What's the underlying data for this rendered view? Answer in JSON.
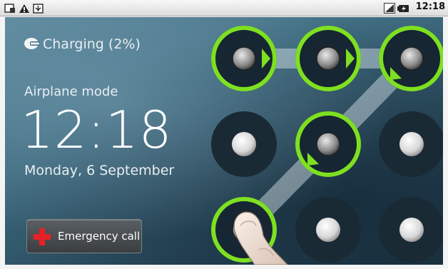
{
  "status_bar": {
    "left_icons": [
      "usb-debug-icon",
      "warning-icon",
      "usb-icon"
    ],
    "right_icons": [
      "signal-icon",
      "battery-charging-icon"
    ],
    "time": "12:18"
  },
  "lock_screen": {
    "charging_text": "Charging (2%)",
    "airplane_mode": "Airplane mode",
    "clock": "12:18",
    "date": "Monday, 6 September",
    "emergency_button": "Emergency call"
  },
  "pattern": {
    "selected_dots": [
      1,
      2,
      3,
      5,
      7
    ],
    "accent_color": "#7ee021"
  }
}
